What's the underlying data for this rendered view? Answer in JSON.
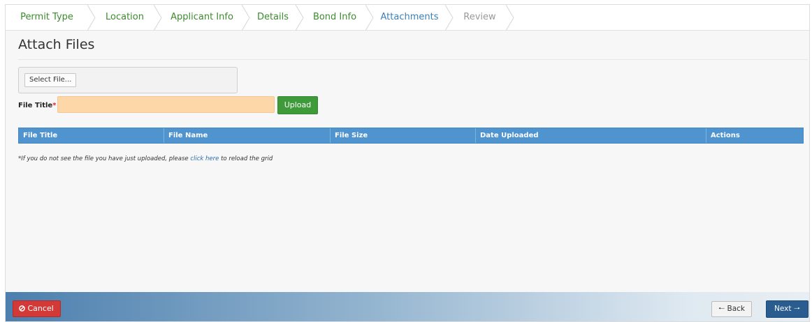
{
  "wizard": {
    "steps": [
      {
        "label": "Permit Type",
        "state": "done"
      },
      {
        "label": "Location",
        "state": "done"
      },
      {
        "label": "Applicant Info",
        "state": "done"
      },
      {
        "label": "Details",
        "state": "done"
      },
      {
        "label": "Bond Info",
        "state": "done"
      },
      {
        "label": "Attachments",
        "state": "current"
      },
      {
        "label": "Review",
        "state": "todo"
      }
    ]
  },
  "page": {
    "title": "Attach Files"
  },
  "upload": {
    "select_file_label": "Select File...",
    "file_title_label": "File Title",
    "required_marker": "*",
    "file_title_value": "",
    "upload_label": "Upload"
  },
  "grid": {
    "columns": [
      "File Title",
      "File Name",
      "File Size",
      "Date Uploaded",
      "Actions"
    ],
    "note_prefix": "*If you do not see the file you have just uploaded, please ",
    "note_link": "click here",
    "note_suffix": " to reload the grid"
  },
  "footer": {
    "cancel_label": "Cancel",
    "back_label": "Back",
    "next_label": "Next"
  },
  "colors": {
    "step_done": "#3c8a2e",
    "step_current": "#3a7fb8",
    "step_todo": "#9a9a9a",
    "grid_header": "#4f93cf",
    "upload_button": "#3f9a3a",
    "cancel_button": "#d33a37",
    "next_button": "#2a5c8f",
    "required_field_bg": "#fdd7a8"
  },
  "icons": {
    "cancel": "ban-icon",
    "back": "arrow-left-icon",
    "next": "arrow-right-icon"
  }
}
